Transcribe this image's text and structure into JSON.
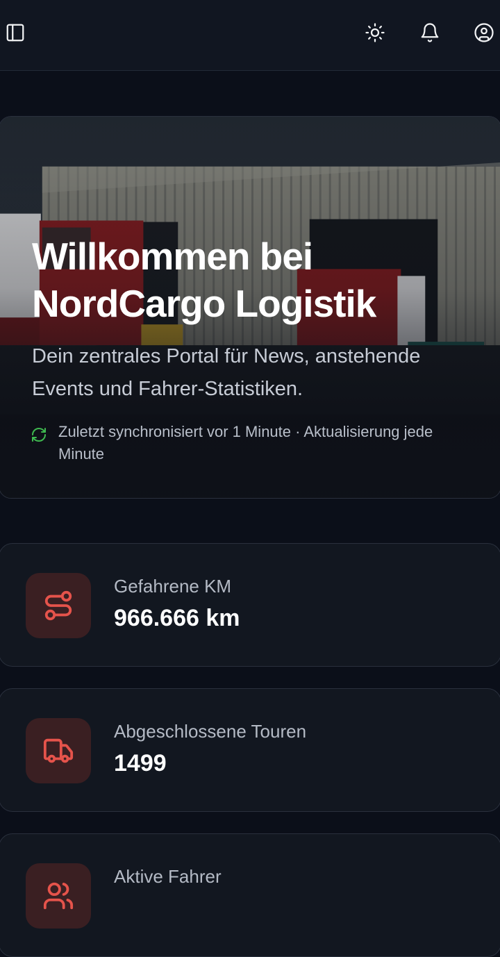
{
  "topbar": {
    "sidebar_toggle_icon": "sidebar-toggle-icon",
    "theme_icon": "sun-icon",
    "notifications_icon": "bell-icon",
    "account_icon": "user-circle-icon"
  },
  "hero": {
    "title": "Willkommen bei\nNordCargo Logistik",
    "subtitle": "Dein zentrales Portal für News, anstehende Events und Fahrer-Statistiken.",
    "sync_text": "Zuletzt synchronisiert vor 1 Minute · Aktualisierung jede Minute",
    "sync_icon": "refresh-icon"
  },
  "stats": [
    {
      "label": "Gefahrene KM",
      "value": "966.666 km",
      "icon": "route-icon"
    },
    {
      "label": "Abgeschlossene Touren",
      "value": "1499",
      "icon": "truck-icon"
    },
    {
      "label": "Aktive Fahrer",
      "value": "",
      "icon": "users-icon"
    }
  ],
  "colors": {
    "accent": "#e5534b",
    "accent_bg": "#3a1f22",
    "sync_green": "#3fb950",
    "background": "#0b0f19",
    "card": "#121720"
  }
}
